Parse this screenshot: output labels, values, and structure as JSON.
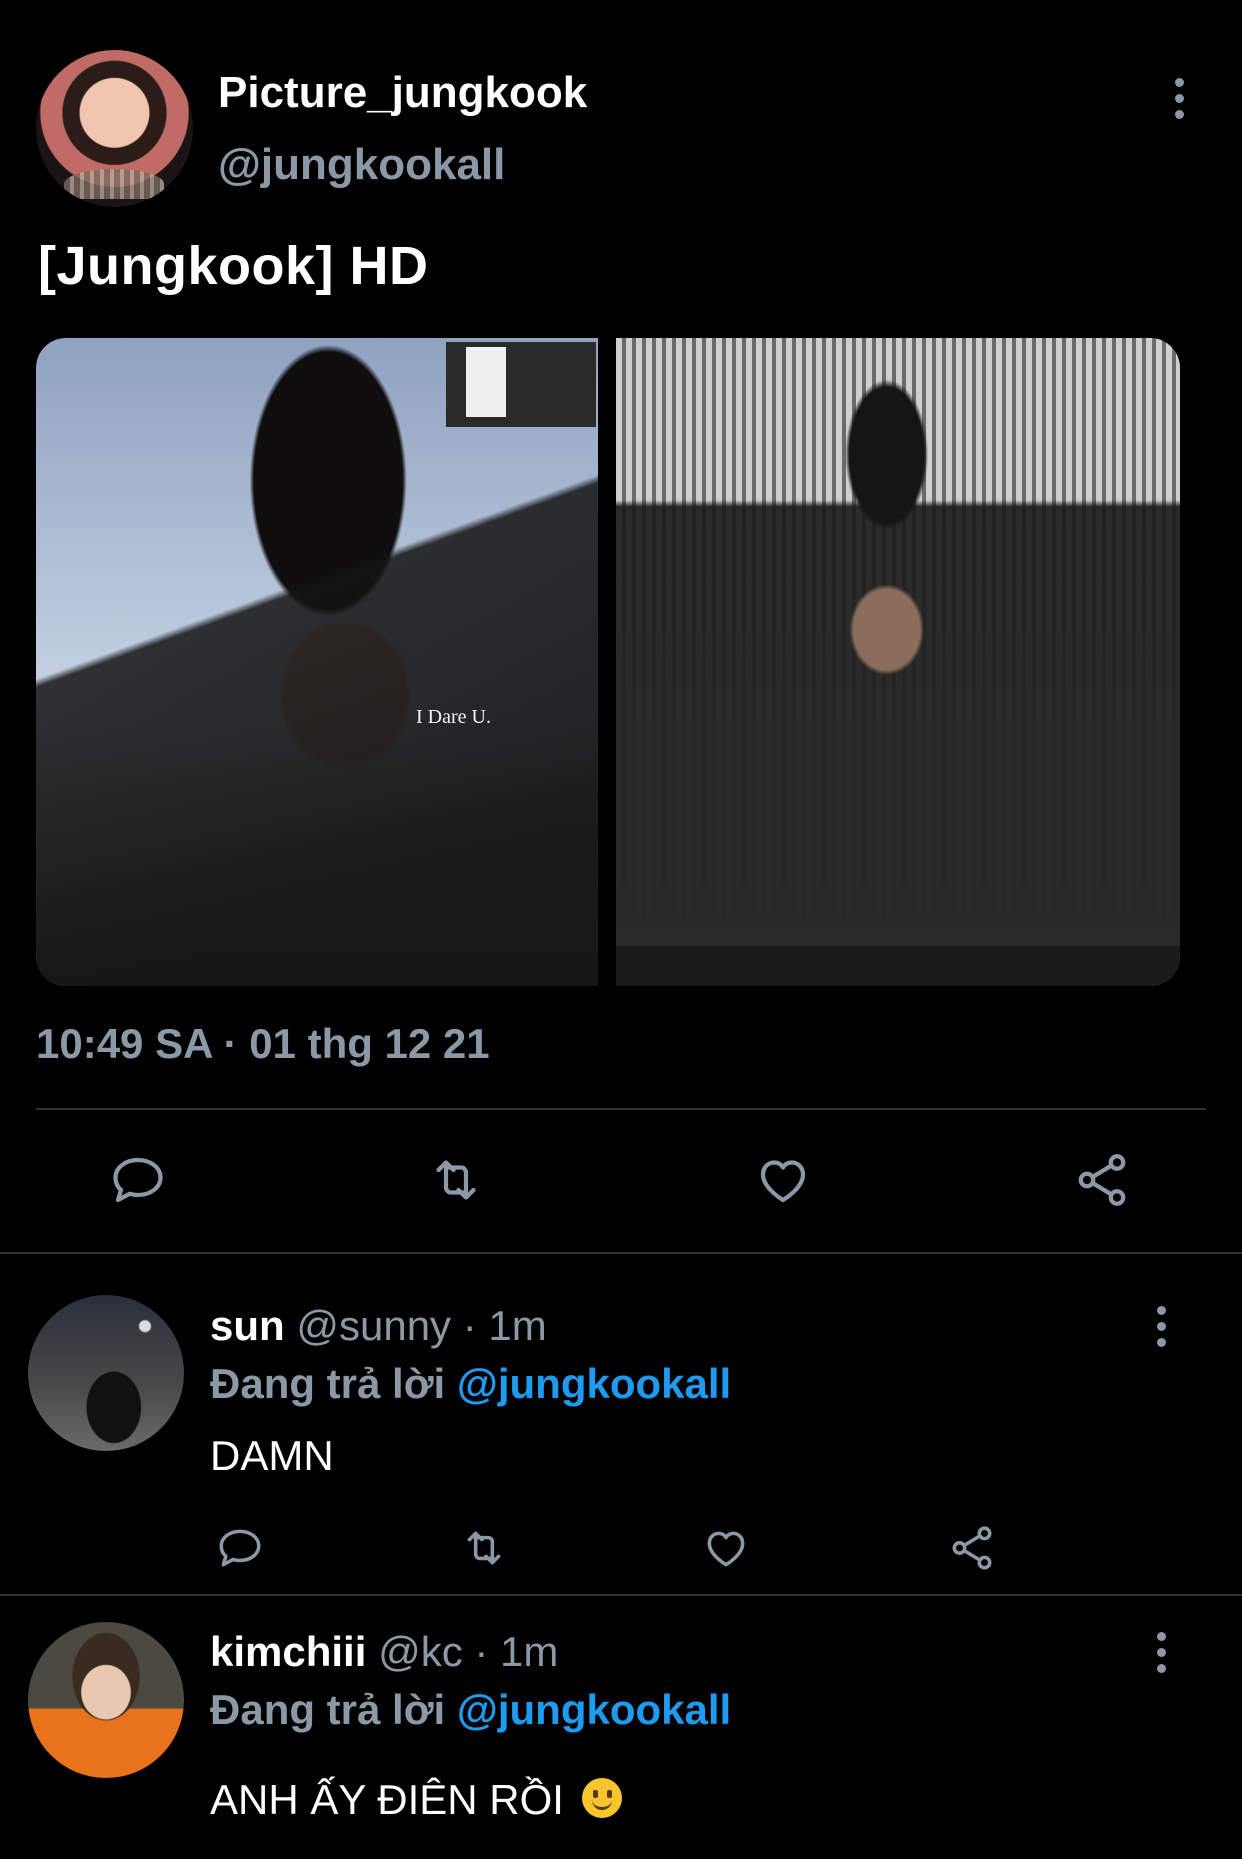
{
  "tweet": {
    "display_name": "Picture_jungkook",
    "handle": "@jungkookall",
    "text": "[Jungkook] HD",
    "image_caption": "I Dare U.",
    "timestamp": "10:49 SA · 01 thg 12 21"
  },
  "replies": [
    {
      "name": "sun",
      "handle": "@sunny",
      "time": "· 1m",
      "replying_prefix": "Đang trả lời",
      "replying_to": "@jungkookall",
      "text": "DAMN"
    },
    {
      "name": "kimchiii",
      "handle": "@kc",
      "time": "· 1m",
      "replying_prefix": "Đang trả lời",
      "replying_to": "@jungkookall",
      "text": "ANH ẤY ĐIÊN RỒI"
    }
  ],
  "icons": {
    "more": "more-vertical-icon",
    "reply": "reply-icon",
    "retweet": "retweet-icon",
    "like": "like-icon",
    "share": "share-icon",
    "emoji": "smiling-face-emoji"
  },
  "colors": {
    "background": "#000000",
    "text_primary": "#ffffff",
    "text_secondary": "#8b98a5",
    "accent": "#1d9bf0",
    "divider": "#2f3336"
  }
}
